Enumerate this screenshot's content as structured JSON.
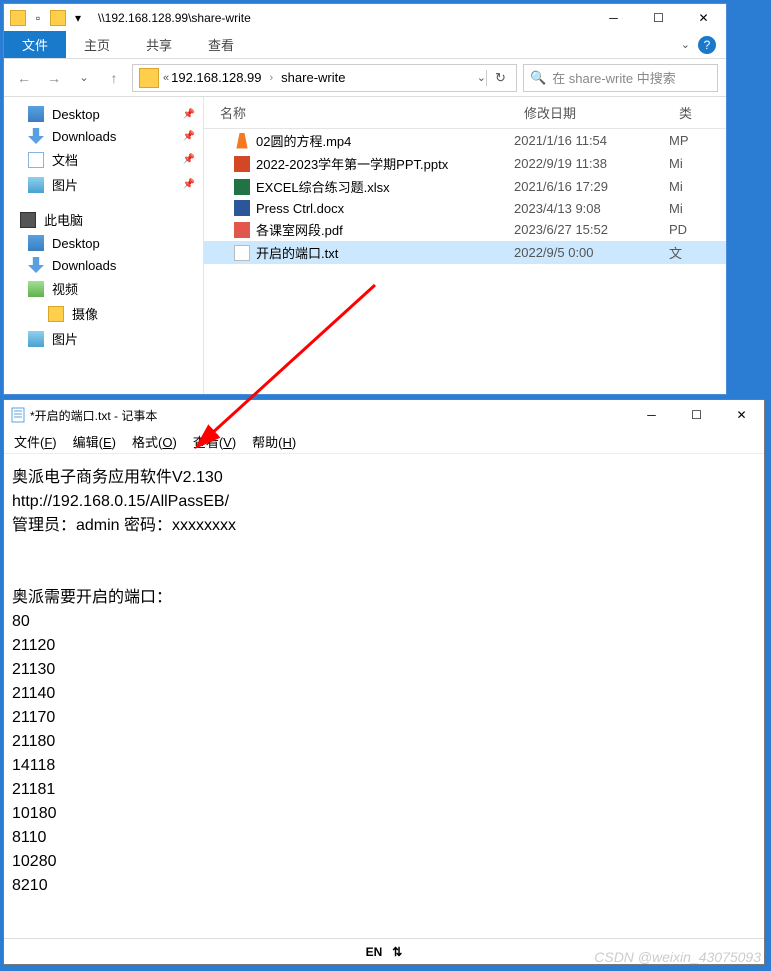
{
  "explorer": {
    "title": "\\\\192.168.128.99\\share-write",
    "tabs": {
      "file": "文件",
      "home": "主页",
      "share": "共享",
      "view": "查看"
    },
    "breadcrumb": [
      "192.168.128.99",
      "share-write"
    ],
    "search_placeholder": "在 share-write 中搜索",
    "sidebar_quick": [
      {
        "label": "Desktop",
        "icon": "desktop",
        "pin": true
      },
      {
        "label": "Downloads",
        "icon": "download",
        "pin": true
      },
      {
        "label": "文档",
        "icon": "doc",
        "pin": true
      },
      {
        "label": "图片",
        "icon": "pic",
        "pin": true
      }
    ],
    "sidebar_pc_label": "此电脑",
    "sidebar_pc": [
      {
        "label": "Desktop",
        "icon": "desktop"
      },
      {
        "label": "Downloads",
        "icon": "download"
      },
      {
        "label": "视频",
        "icon": "video"
      },
      {
        "label": "摄像",
        "icon": "folder",
        "sub": true
      },
      {
        "label": "图片",
        "icon": "pic"
      }
    ],
    "columns": {
      "name": "名称",
      "date": "修改日期",
      "type": "类"
    },
    "files": [
      {
        "name": "02圆的方程.mp4",
        "date": "2021/1/16 11:54",
        "type": "MP",
        "icon": "vlc"
      },
      {
        "name": "2022-2023学年第一学期PPT.pptx",
        "date": "2022/9/19 11:38",
        "type": "Mi",
        "icon": "ppt"
      },
      {
        "name": "EXCEL综合练习题.xlsx",
        "date": "2021/6/16 17:29",
        "type": "Mi",
        "icon": "xls"
      },
      {
        "name": "Press Ctrl.docx",
        "date": "2023/4/13 9:08",
        "type": "Mi",
        "icon": "docx"
      },
      {
        "name": "各课室网段.pdf",
        "date": "2023/6/27 15:52",
        "type": "PD",
        "icon": "pdf"
      },
      {
        "name": "开启的端口.txt",
        "date": "2022/9/5 0:00",
        "type": "文",
        "icon": "txt",
        "selected": true
      }
    ]
  },
  "notepad": {
    "title": "*开启的端口.txt - 记事本",
    "menus": {
      "file": "文件(F)",
      "edit": "编辑(E)",
      "format": "格式(O)",
      "view": "查看(V)",
      "help": "帮助(H)"
    },
    "content": "奥派电子商务应用软件V2.130\nhttp://192.168.0.15/AllPassEB/\n管理员：admin 密码：xxxxxxxx\n\n\n奥派需要开启的端口：\n80\n21120\n21130\n21140\n21170\n21180\n14118\n21181\n10180\n8110\n10280\n8210",
    "status_lang": "EN"
  },
  "watermark": "CSDN @weixin_43075093"
}
